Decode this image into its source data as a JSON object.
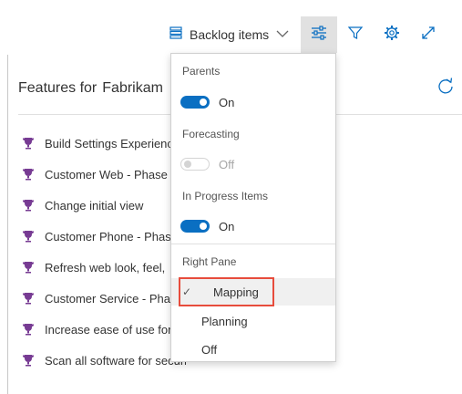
{
  "toolbar": {
    "backlog_label": "Backlog items",
    "icons": [
      "backlog-list-icon",
      "chevron-down-icon",
      "view-options-icon",
      "filter-icon",
      "gear-icon",
      "expand-icon"
    ]
  },
  "panel": {
    "title_prefix": "Features for",
    "title_team": "Fabrikam",
    "features": [
      "Build Settings Experience",
      "Customer Web - Phase",
      "Change initial view",
      "Customer Phone - Phase",
      "Refresh web look, feel,",
      "Customer Service - Phase",
      "Increase ease of use for",
      "Scan all software for security"
    ]
  },
  "menu": {
    "parents": {
      "label": "Parents",
      "state": "On"
    },
    "forecasting": {
      "label": "Forecasting",
      "state": "Off"
    },
    "in_progress": {
      "label": "In Progress Items",
      "state": "On"
    },
    "right_pane": {
      "label": "Right Pane",
      "options": [
        "Mapping",
        "Planning",
        "Off"
      ],
      "selected": "Mapping"
    }
  },
  "colors": {
    "accent": "#0a6fc2",
    "trophy": "#773b93",
    "highlight": "#e74c3c"
  }
}
